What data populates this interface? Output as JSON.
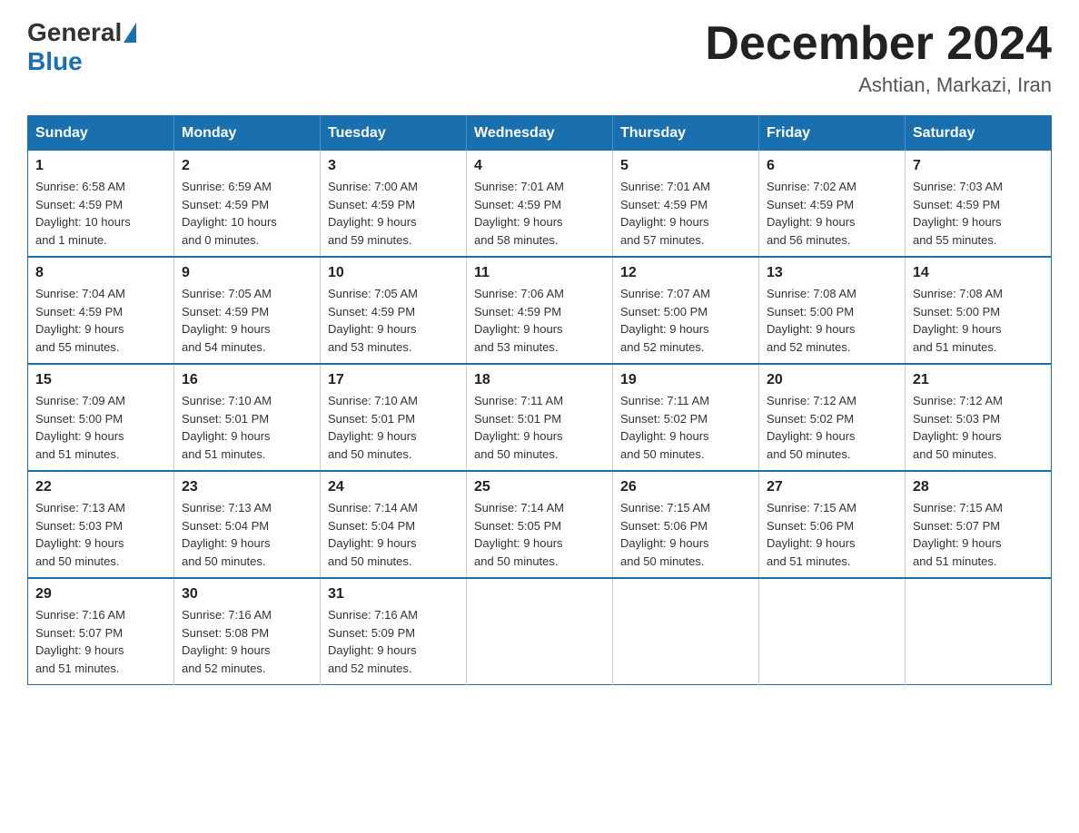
{
  "header": {
    "logo_general": "General",
    "logo_blue": "Blue",
    "month_title": "December 2024",
    "location": "Ashtian, Markazi, Iran"
  },
  "days_of_week": [
    "Sunday",
    "Monday",
    "Tuesday",
    "Wednesday",
    "Thursday",
    "Friday",
    "Saturday"
  ],
  "weeks": [
    [
      {
        "day": "1",
        "sunrise": "6:58 AM",
        "sunset": "4:59 PM",
        "daylight": "10 hours and 1 minute."
      },
      {
        "day": "2",
        "sunrise": "6:59 AM",
        "sunset": "4:59 PM",
        "daylight": "10 hours and 0 minutes."
      },
      {
        "day": "3",
        "sunrise": "7:00 AM",
        "sunset": "4:59 PM",
        "daylight": "9 hours and 59 minutes."
      },
      {
        "day": "4",
        "sunrise": "7:01 AM",
        "sunset": "4:59 PM",
        "daylight": "9 hours and 58 minutes."
      },
      {
        "day": "5",
        "sunrise": "7:01 AM",
        "sunset": "4:59 PM",
        "daylight": "9 hours and 57 minutes."
      },
      {
        "day": "6",
        "sunrise": "7:02 AM",
        "sunset": "4:59 PM",
        "daylight": "9 hours and 56 minutes."
      },
      {
        "day": "7",
        "sunrise": "7:03 AM",
        "sunset": "4:59 PM",
        "daylight": "9 hours and 55 minutes."
      }
    ],
    [
      {
        "day": "8",
        "sunrise": "7:04 AM",
        "sunset": "4:59 PM",
        "daylight": "9 hours and 55 minutes."
      },
      {
        "day": "9",
        "sunrise": "7:05 AM",
        "sunset": "4:59 PM",
        "daylight": "9 hours and 54 minutes."
      },
      {
        "day": "10",
        "sunrise": "7:05 AM",
        "sunset": "4:59 PM",
        "daylight": "9 hours and 53 minutes."
      },
      {
        "day": "11",
        "sunrise": "7:06 AM",
        "sunset": "4:59 PM",
        "daylight": "9 hours and 53 minutes."
      },
      {
        "day": "12",
        "sunrise": "7:07 AM",
        "sunset": "5:00 PM",
        "daylight": "9 hours and 52 minutes."
      },
      {
        "day": "13",
        "sunrise": "7:08 AM",
        "sunset": "5:00 PM",
        "daylight": "9 hours and 52 minutes."
      },
      {
        "day": "14",
        "sunrise": "7:08 AM",
        "sunset": "5:00 PM",
        "daylight": "9 hours and 51 minutes."
      }
    ],
    [
      {
        "day": "15",
        "sunrise": "7:09 AM",
        "sunset": "5:00 PM",
        "daylight": "9 hours and 51 minutes."
      },
      {
        "day": "16",
        "sunrise": "7:10 AM",
        "sunset": "5:01 PM",
        "daylight": "9 hours and 51 minutes."
      },
      {
        "day": "17",
        "sunrise": "7:10 AM",
        "sunset": "5:01 PM",
        "daylight": "9 hours and 50 minutes."
      },
      {
        "day": "18",
        "sunrise": "7:11 AM",
        "sunset": "5:01 PM",
        "daylight": "9 hours and 50 minutes."
      },
      {
        "day": "19",
        "sunrise": "7:11 AM",
        "sunset": "5:02 PM",
        "daylight": "9 hours and 50 minutes."
      },
      {
        "day": "20",
        "sunrise": "7:12 AM",
        "sunset": "5:02 PM",
        "daylight": "9 hours and 50 minutes."
      },
      {
        "day": "21",
        "sunrise": "7:12 AM",
        "sunset": "5:03 PM",
        "daylight": "9 hours and 50 minutes."
      }
    ],
    [
      {
        "day": "22",
        "sunrise": "7:13 AM",
        "sunset": "5:03 PM",
        "daylight": "9 hours and 50 minutes."
      },
      {
        "day": "23",
        "sunrise": "7:13 AM",
        "sunset": "5:04 PM",
        "daylight": "9 hours and 50 minutes."
      },
      {
        "day": "24",
        "sunrise": "7:14 AM",
        "sunset": "5:04 PM",
        "daylight": "9 hours and 50 minutes."
      },
      {
        "day": "25",
        "sunrise": "7:14 AM",
        "sunset": "5:05 PM",
        "daylight": "9 hours and 50 minutes."
      },
      {
        "day": "26",
        "sunrise": "7:15 AM",
        "sunset": "5:06 PM",
        "daylight": "9 hours and 50 minutes."
      },
      {
        "day": "27",
        "sunrise": "7:15 AM",
        "sunset": "5:06 PM",
        "daylight": "9 hours and 51 minutes."
      },
      {
        "day": "28",
        "sunrise": "7:15 AM",
        "sunset": "5:07 PM",
        "daylight": "9 hours and 51 minutes."
      }
    ],
    [
      {
        "day": "29",
        "sunrise": "7:16 AM",
        "sunset": "5:07 PM",
        "daylight": "9 hours and 51 minutes."
      },
      {
        "day": "30",
        "sunrise": "7:16 AM",
        "sunset": "5:08 PM",
        "daylight": "9 hours and 52 minutes."
      },
      {
        "day": "31",
        "sunrise": "7:16 AM",
        "sunset": "5:09 PM",
        "daylight": "9 hours and 52 minutes."
      },
      null,
      null,
      null,
      null
    ]
  ],
  "labels": {
    "sunrise": "Sunrise:",
    "sunset": "Sunset:",
    "daylight": "Daylight:"
  }
}
